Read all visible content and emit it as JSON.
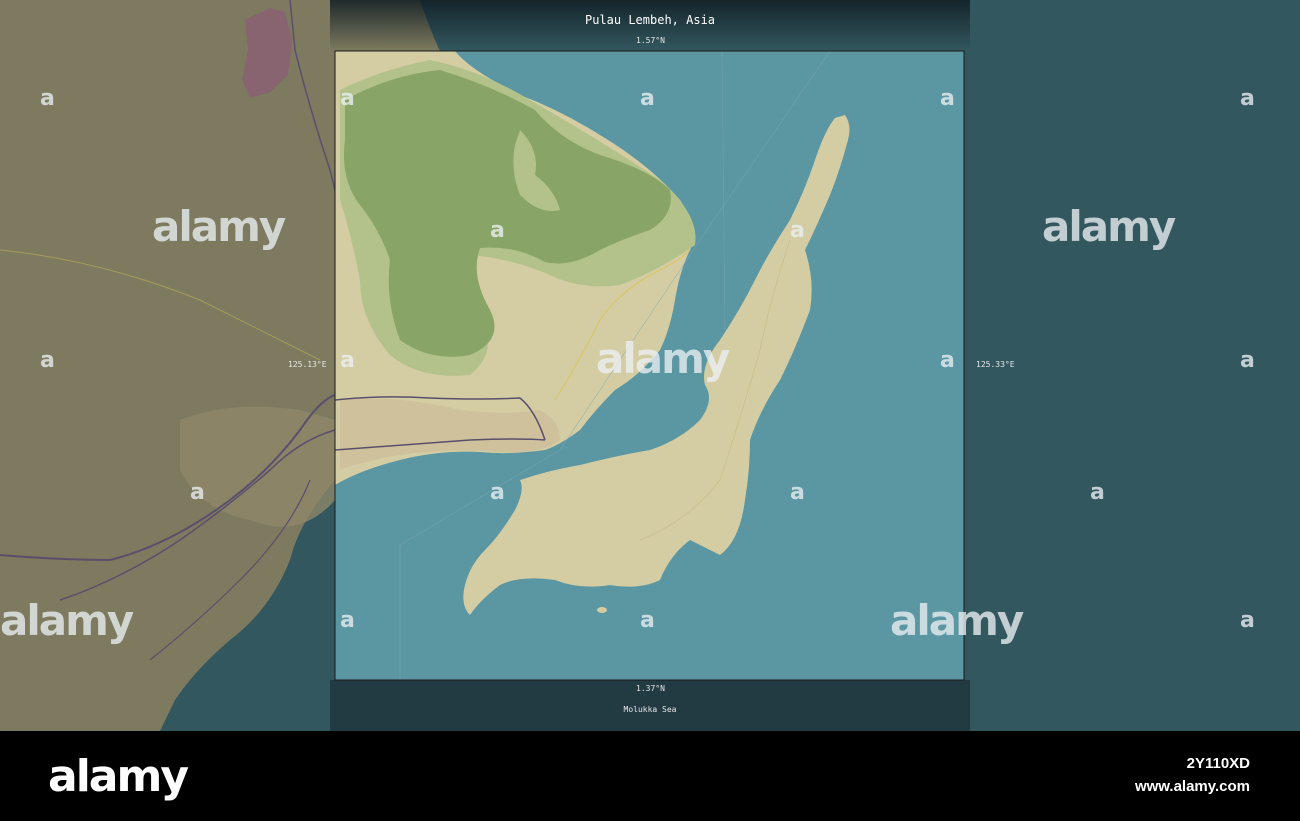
{
  "map": {
    "title": "Pulau Lembeh, Asia",
    "lat_top": "1.57°N",
    "lat_bottom": "1.37°N",
    "lon_left": "125.13°E",
    "lon_right": "125.33°E",
    "sea_name": "Molukka Sea"
  },
  "watermark": {
    "brand": "alamy",
    "letter": "a"
  },
  "footer": {
    "logo": "alamy",
    "image_id": "2Y110XD",
    "url": "www.alamy.com"
  },
  "colors": {
    "sea_dark": "#33575f",
    "sea_light": "#5b96a3",
    "land_dim": "#7d7a5f",
    "land_light": "#d4cda3",
    "forest": "#88a466",
    "forest_light": "#b2c28a",
    "urban": "#9a8a7a",
    "road": "#5a4f6c"
  }
}
